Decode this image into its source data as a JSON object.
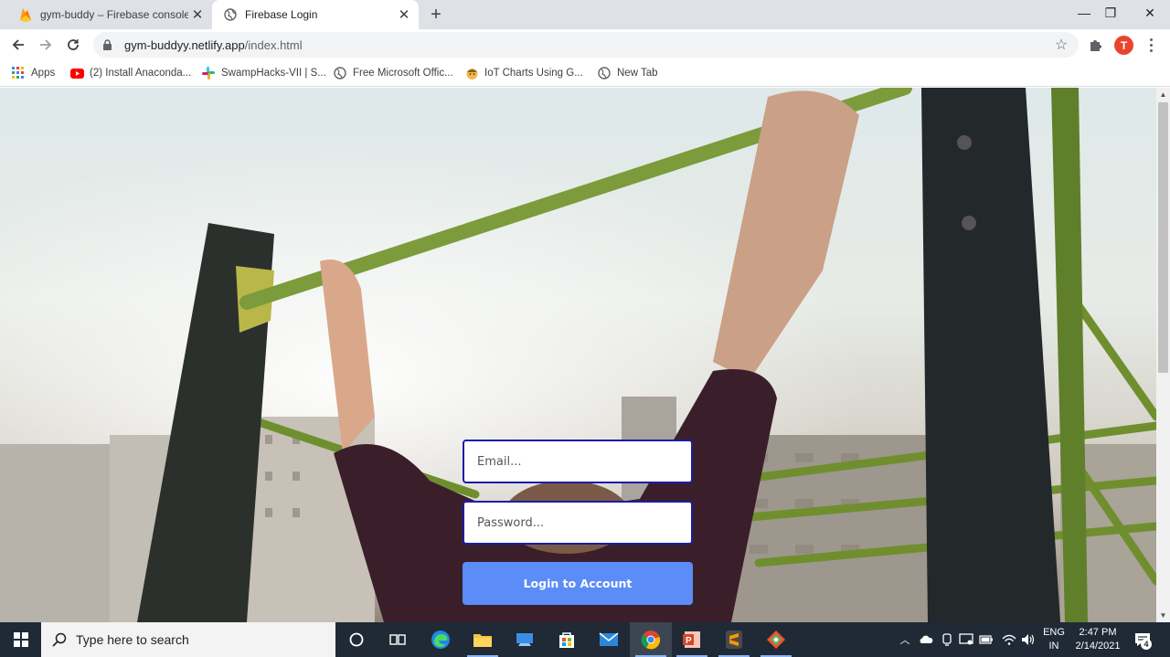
{
  "browser": {
    "tabs": [
      {
        "title": "gym-buddy – Firebase console",
        "active": false,
        "icon": "firebase-icon"
      },
      {
        "title": "Firebase Login",
        "active": true,
        "icon": "globe-icon"
      }
    ],
    "window_controls": {
      "minimize": "—",
      "maximize": "❐",
      "close": "✕"
    },
    "address": {
      "host": "gym-buddyy.netlify.app",
      "path": "/index.html"
    },
    "profile_initial": "T",
    "bookmarks": [
      {
        "label": "Apps",
        "icon": "apps-grid-icon"
      },
      {
        "label": "(2) Install Anaconda...",
        "icon": "youtube-icon"
      },
      {
        "label": "SwampHacks-VII | S...",
        "icon": "slack-icon"
      },
      {
        "label": "Free Microsoft Offic...",
        "icon": "globe-icon"
      },
      {
        "label": "IoT Charts Using G...",
        "icon": "avatar-emoji-icon"
      },
      {
        "label": "New Tab",
        "icon": "globe-icon"
      }
    ]
  },
  "login": {
    "email_placeholder": "Email...",
    "password_placeholder": "Password...",
    "submit_label": "Login to Account",
    "colors": {
      "field_border": "#1d1ba8",
      "button": "#5b8cf7"
    }
  },
  "taskbar": {
    "search_placeholder": "Type here to search",
    "apps": [
      "cortana-icon",
      "task-view-icon",
      "edge-icon",
      "file-explorer-icon",
      "cloud-app-icon",
      "store-icon",
      "mail-icon",
      "chrome-icon",
      "powerpoint-icon",
      "sublime-text-icon",
      "git-icon"
    ],
    "language": {
      "line1": "ENG",
      "line2": "IN"
    },
    "clock": {
      "time": "2:47 PM",
      "date": "2/14/2021"
    },
    "notifications_count": "4"
  }
}
